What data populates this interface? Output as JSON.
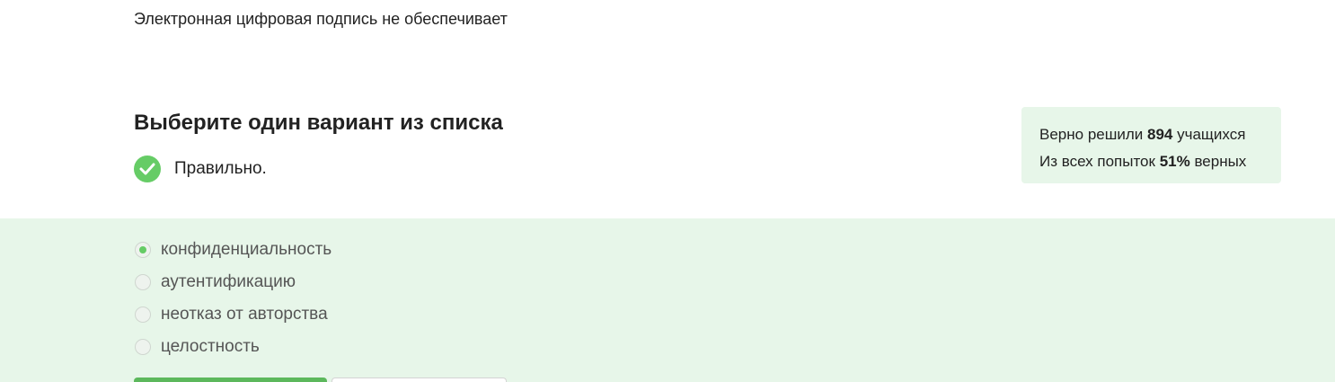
{
  "question": {
    "text": "Электронная цифровая подпись не обеспечивает"
  },
  "instruction": {
    "title": "Выберите один вариант из списка"
  },
  "result": {
    "icon": "check-circle-icon",
    "label": "Правильно.",
    "color": "#66cc66"
  },
  "stats": {
    "solved_prefix": "Верно решили ",
    "solved_count": "894",
    "solved_suffix": " учащихся",
    "attempts_prefix": "Из всех попыток ",
    "attempts_percent": "51%",
    "attempts_suffix": " верных"
  },
  "options": [
    {
      "label": "конфиденциальность",
      "selected": true
    },
    {
      "label": "аутентификацию",
      "selected": false
    },
    {
      "label": "неотказ от авторства",
      "selected": false
    },
    {
      "label": "целостность",
      "selected": false
    }
  ],
  "colors": {
    "accent": "#66cc66",
    "panel_background": "#e7f6e9",
    "primary_button": "#5cb85c"
  }
}
